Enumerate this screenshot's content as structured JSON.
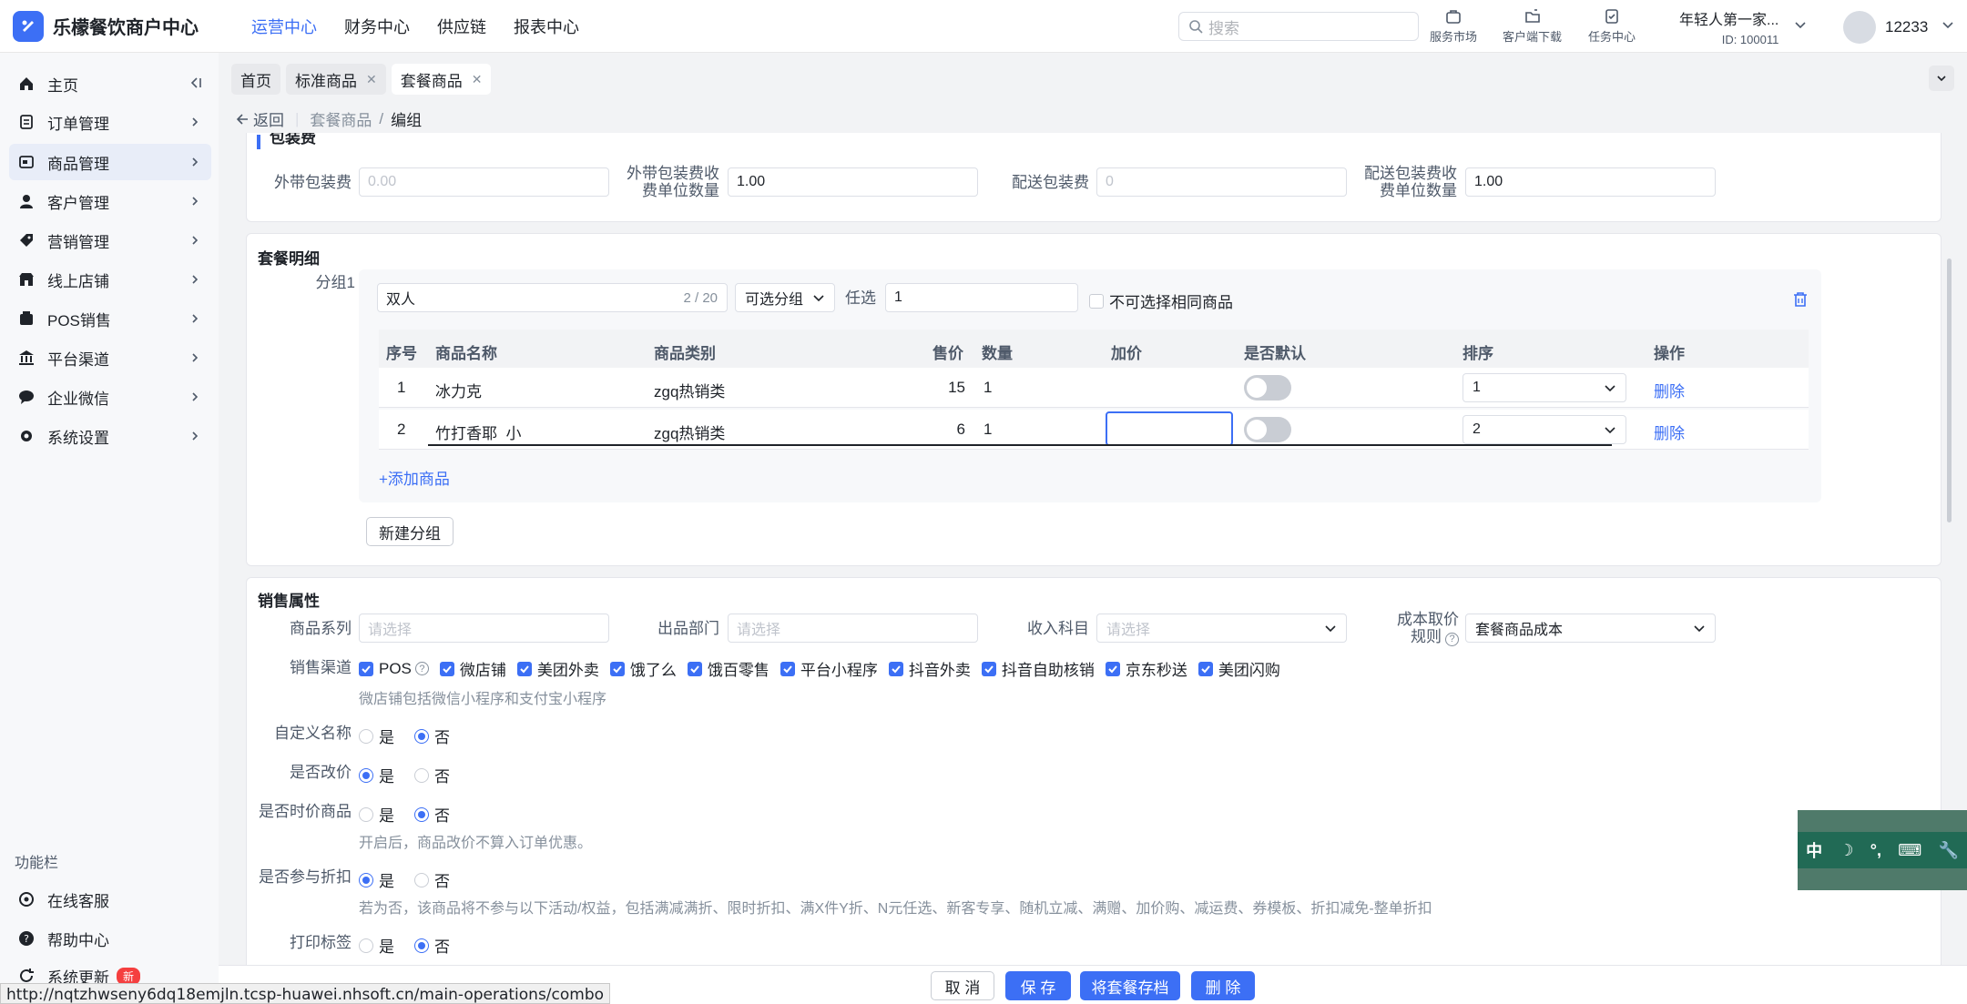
{
  "app": {
    "title": "乐檬餐饮商户中心"
  },
  "topnav": [
    {
      "label": "运营中心",
      "active": true
    },
    {
      "label": "财务中心",
      "active": false
    },
    {
      "label": "供应链",
      "active": false
    },
    {
      "label": "报表中心",
      "active": false
    }
  ],
  "search": {
    "placeholder": "搜索"
  },
  "tools": [
    {
      "label": "服务市场",
      "icon": "shop-icon"
    },
    {
      "label": "客户端下载",
      "icon": "download-icon"
    },
    {
      "label": "任务中心",
      "icon": "task-icon"
    }
  ],
  "store": {
    "name": "年轻人第一家...",
    "id": "ID: 100011"
  },
  "user": {
    "name": "12233"
  },
  "sidebar": {
    "items": [
      {
        "label": "主页",
        "icon": "home-icon"
      },
      {
        "label": "订单管理",
        "icon": "order-icon"
      },
      {
        "label": "商品管理",
        "icon": "goods-icon"
      },
      {
        "label": "客户管理",
        "icon": "customer-icon"
      },
      {
        "label": "营销管理",
        "icon": "marketing-icon"
      },
      {
        "label": "线上店铺",
        "icon": "store-icon"
      },
      {
        "label": "POS销售",
        "icon": "pos-icon"
      },
      {
        "label": "平台渠道",
        "icon": "channel-icon"
      },
      {
        "label": "企业微信",
        "icon": "wechat-icon"
      },
      {
        "label": "系统设置",
        "icon": "gear-icon"
      }
    ],
    "func_title": "功能栏",
    "func_items": [
      {
        "label": "在线客服",
        "icon": "service-icon"
      },
      {
        "label": "帮助中心",
        "icon": "help-icon"
      },
      {
        "label": "系统更新",
        "icon": "refresh-icon",
        "badge": "新"
      }
    ]
  },
  "tabs": [
    {
      "label": "首页",
      "closable": false
    },
    {
      "label": "标准商品",
      "closable": true
    },
    {
      "label": "套餐商品",
      "closable": true
    }
  ],
  "breadcrumb": {
    "back": "返回",
    "parent": "套餐商品",
    "sep": "/",
    "current": "编组"
  },
  "packing": {
    "title": "包装费",
    "takeaway_fee_label": "外带包装费",
    "takeaway_fee_placeholder": "0.00",
    "takeaway_unit_label_1": "外带包装费收",
    "takeaway_unit_label_2": "费单位数量",
    "takeaway_unit_value": "1.00",
    "delivery_fee_label": "配送包装费",
    "delivery_fee_placeholder": "0",
    "delivery_unit_label_1": "配送包装费收",
    "delivery_unit_label_2": "费单位数量",
    "delivery_unit_value": "1.00"
  },
  "combo": {
    "title": "套餐明细",
    "group_label": "分组1",
    "group_name": "双人",
    "group_count": "2 / 20",
    "group_type": "可选分组",
    "pick_label": "任选",
    "pick_value": "1",
    "no_same_label": "不可选择相同商品",
    "headers": {
      "no": "序号",
      "name": "商品名称",
      "category": "商品类别",
      "price": "售价",
      "qty": "数量",
      "add_price": "加价",
      "default": "是否默认",
      "sort": "排序",
      "action": "操作"
    },
    "rows": [
      {
        "no": "1",
        "name": "冰力克",
        "category": "zgq热销类",
        "price": "15",
        "qty": "1",
        "add_price": "",
        "sort": "1",
        "action": "删除"
      },
      {
        "no": "2",
        "name": "竹打香耶  小",
        "category": "zgq热销类",
        "price": "6",
        "qty": "1",
        "add_price": "",
        "sort": "2",
        "action": "删除"
      }
    ],
    "add_goods": "+添加商品",
    "new_group": "新建分组"
  },
  "sales": {
    "title": "销售属性",
    "series_label": "商品系列",
    "series_placeholder": "请选择",
    "dept_label": "出品部门",
    "dept_placeholder": "请选择",
    "income_label": "收入科目",
    "income_placeholder": "请选择",
    "cost_label_1": "成本取价",
    "cost_label_2": "规则",
    "cost_value": "套餐商品成本",
    "channel_label": "销售渠道",
    "channels": [
      "POS",
      "微店铺",
      "美团外卖",
      "饿了么",
      "饿百零售",
      "平台小程序",
      "抖音外卖",
      "抖音自助核销",
      "京东秒送",
      "美团闪购"
    ],
    "channel_hint": "微店铺包括微信小程序和支付宝小程序",
    "yes": "是",
    "no": "否",
    "custom_name_label": "自定义名称",
    "change_price_label": "是否改价",
    "timed_price_label": "是否时价商品",
    "timed_price_hint": "开启后，商品改价不算入订单优惠。",
    "discount_label": "是否参与折扣",
    "discount_hint": "若为否，该商品将不参与以下活动/权益，包括满减满折、限时折扣、满X件Y折、N元任选、新客专享、随机立减、满赠、加价购、减运费、券模板、折扣减免-整单折扣",
    "print_label": "打印标签"
  },
  "footer": {
    "cancel": "取 消",
    "save": "保 存",
    "archive": "将套餐存档",
    "delete": "删 除"
  },
  "status_url": "http://nqtzhwseny6dq18emjln.tcsp-huawei.nhsoft.cn/main-operations/combo",
  "ime": {
    "lang": "中",
    "moon": "☽",
    "punct": "°,",
    "keyboard": "⌨",
    "tool": "🔧"
  },
  "colors": {
    "accent": "#3c6ff5",
    "danger": "#f53f3f"
  }
}
